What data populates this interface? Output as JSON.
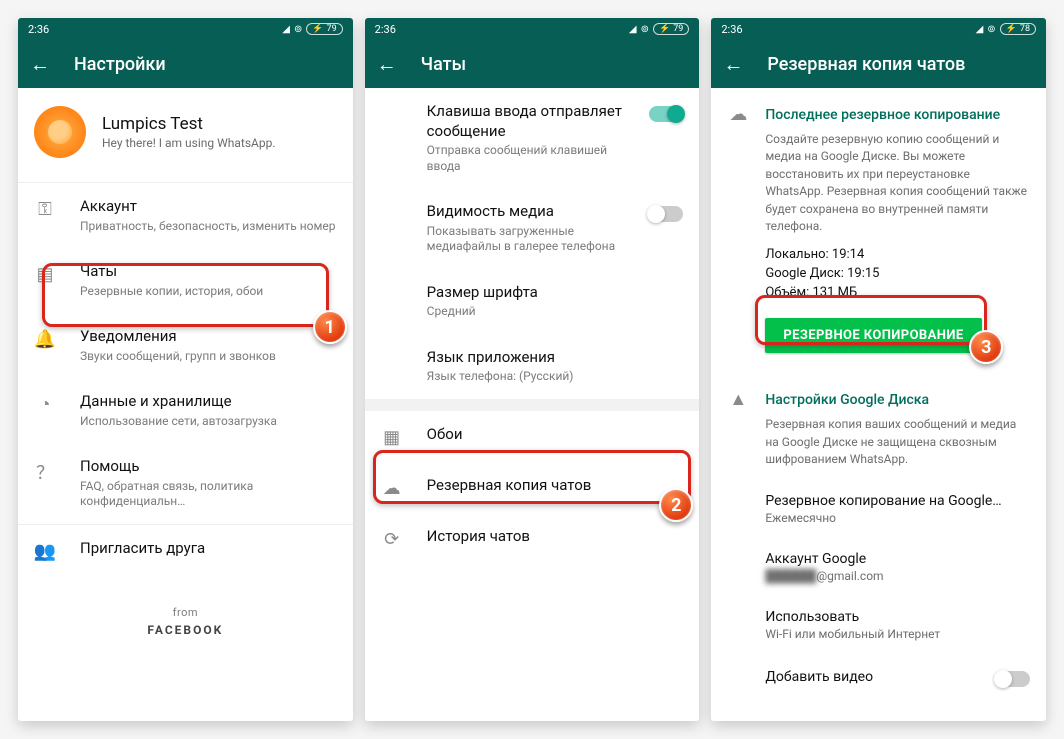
{
  "statusbar": {
    "time": "2:36",
    "battery1": "79",
    "battery2": "79",
    "battery3": "78"
  },
  "screen1": {
    "title": "Настройки",
    "profile_name": "Lumpics Test",
    "profile_status": "Hey there! I am using WhatsApp.",
    "rows": {
      "account": {
        "label": "Аккаунт",
        "sub": "Приватность, безопасность, изменить номер"
      },
      "chats": {
        "label": "Чаты",
        "sub": "Резервные копии, история, обои"
      },
      "notif": {
        "label": "Уведомления",
        "sub": "Звуки сообщений, групп и звонков"
      },
      "data": {
        "label": "Данные и хранилище",
        "sub": "Использование сети, автозагрузка"
      },
      "help": {
        "label": "Помощь",
        "sub": "FAQ, обратная связь, политика конфиденциальн…"
      },
      "invite": {
        "label": "Пригласить друга"
      }
    },
    "from": "from",
    "fb": "FACEBOOK",
    "step": "1"
  },
  "screen2": {
    "title": "Чаты",
    "rows": {
      "enter": {
        "label": "Клавиша ввода отправляет сообщение",
        "sub": "Отправка сообщений клавишей ввода"
      },
      "media": {
        "label": "Видимость медиа",
        "sub": "Показывать загруженные медиафайлы в галерее телефона"
      },
      "font": {
        "label": "Размер шрифта",
        "sub": "Средний"
      },
      "lang": {
        "label": "Язык приложения",
        "sub": "Язык телефона: (Русский)"
      },
      "wall": {
        "label": "Обои"
      },
      "backup": {
        "label": "Резервная копия чатов"
      },
      "history": {
        "label": "История чатов"
      }
    },
    "step": "2"
  },
  "screen3": {
    "title": "Резервная копия чатов",
    "last_backup_head": "Последнее резервное копирование",
    "last_backup_desc": "Создайте резервную копию сообщений и медиа на Google Диске. Вы можете восстановить их при переустановке WhatsApp. Резервная копия сообщений также будет сохранена во внутренней памяти телефона.",
    "stat_local": "Локально: 19:14",
    "stat_drive": "Google Диск: 19:15",
    "stat_size": "Объём: 131 МБ",
    "backup_btn": "РЕЗЕРВНОЕ КОПИРОВАНИЕ",
    "gdrive_head": "Настройки Google Диска",
    "gdrive_desc": "Резервная копия ваших сообщений и медиа на Google Диске не защищена сквозным шифрованием WhatsApp.",
    "freq": {
      "label": "Резервное копирование на Google…",
      "sub": "Ежемесячно"
    },
    "acct": {
      "label": "Аккаунт Google",
      "sub_hidden": "██████",
      "sub_domain": "@gmail.com"
    },
    "net": {
      "label": "Использовать",
      "sub": "Wi-Fi или мобильный Интернет"
    },
    "video": {
      "label": "Добавить видео"
    },
    "step": "3"
  }
}
